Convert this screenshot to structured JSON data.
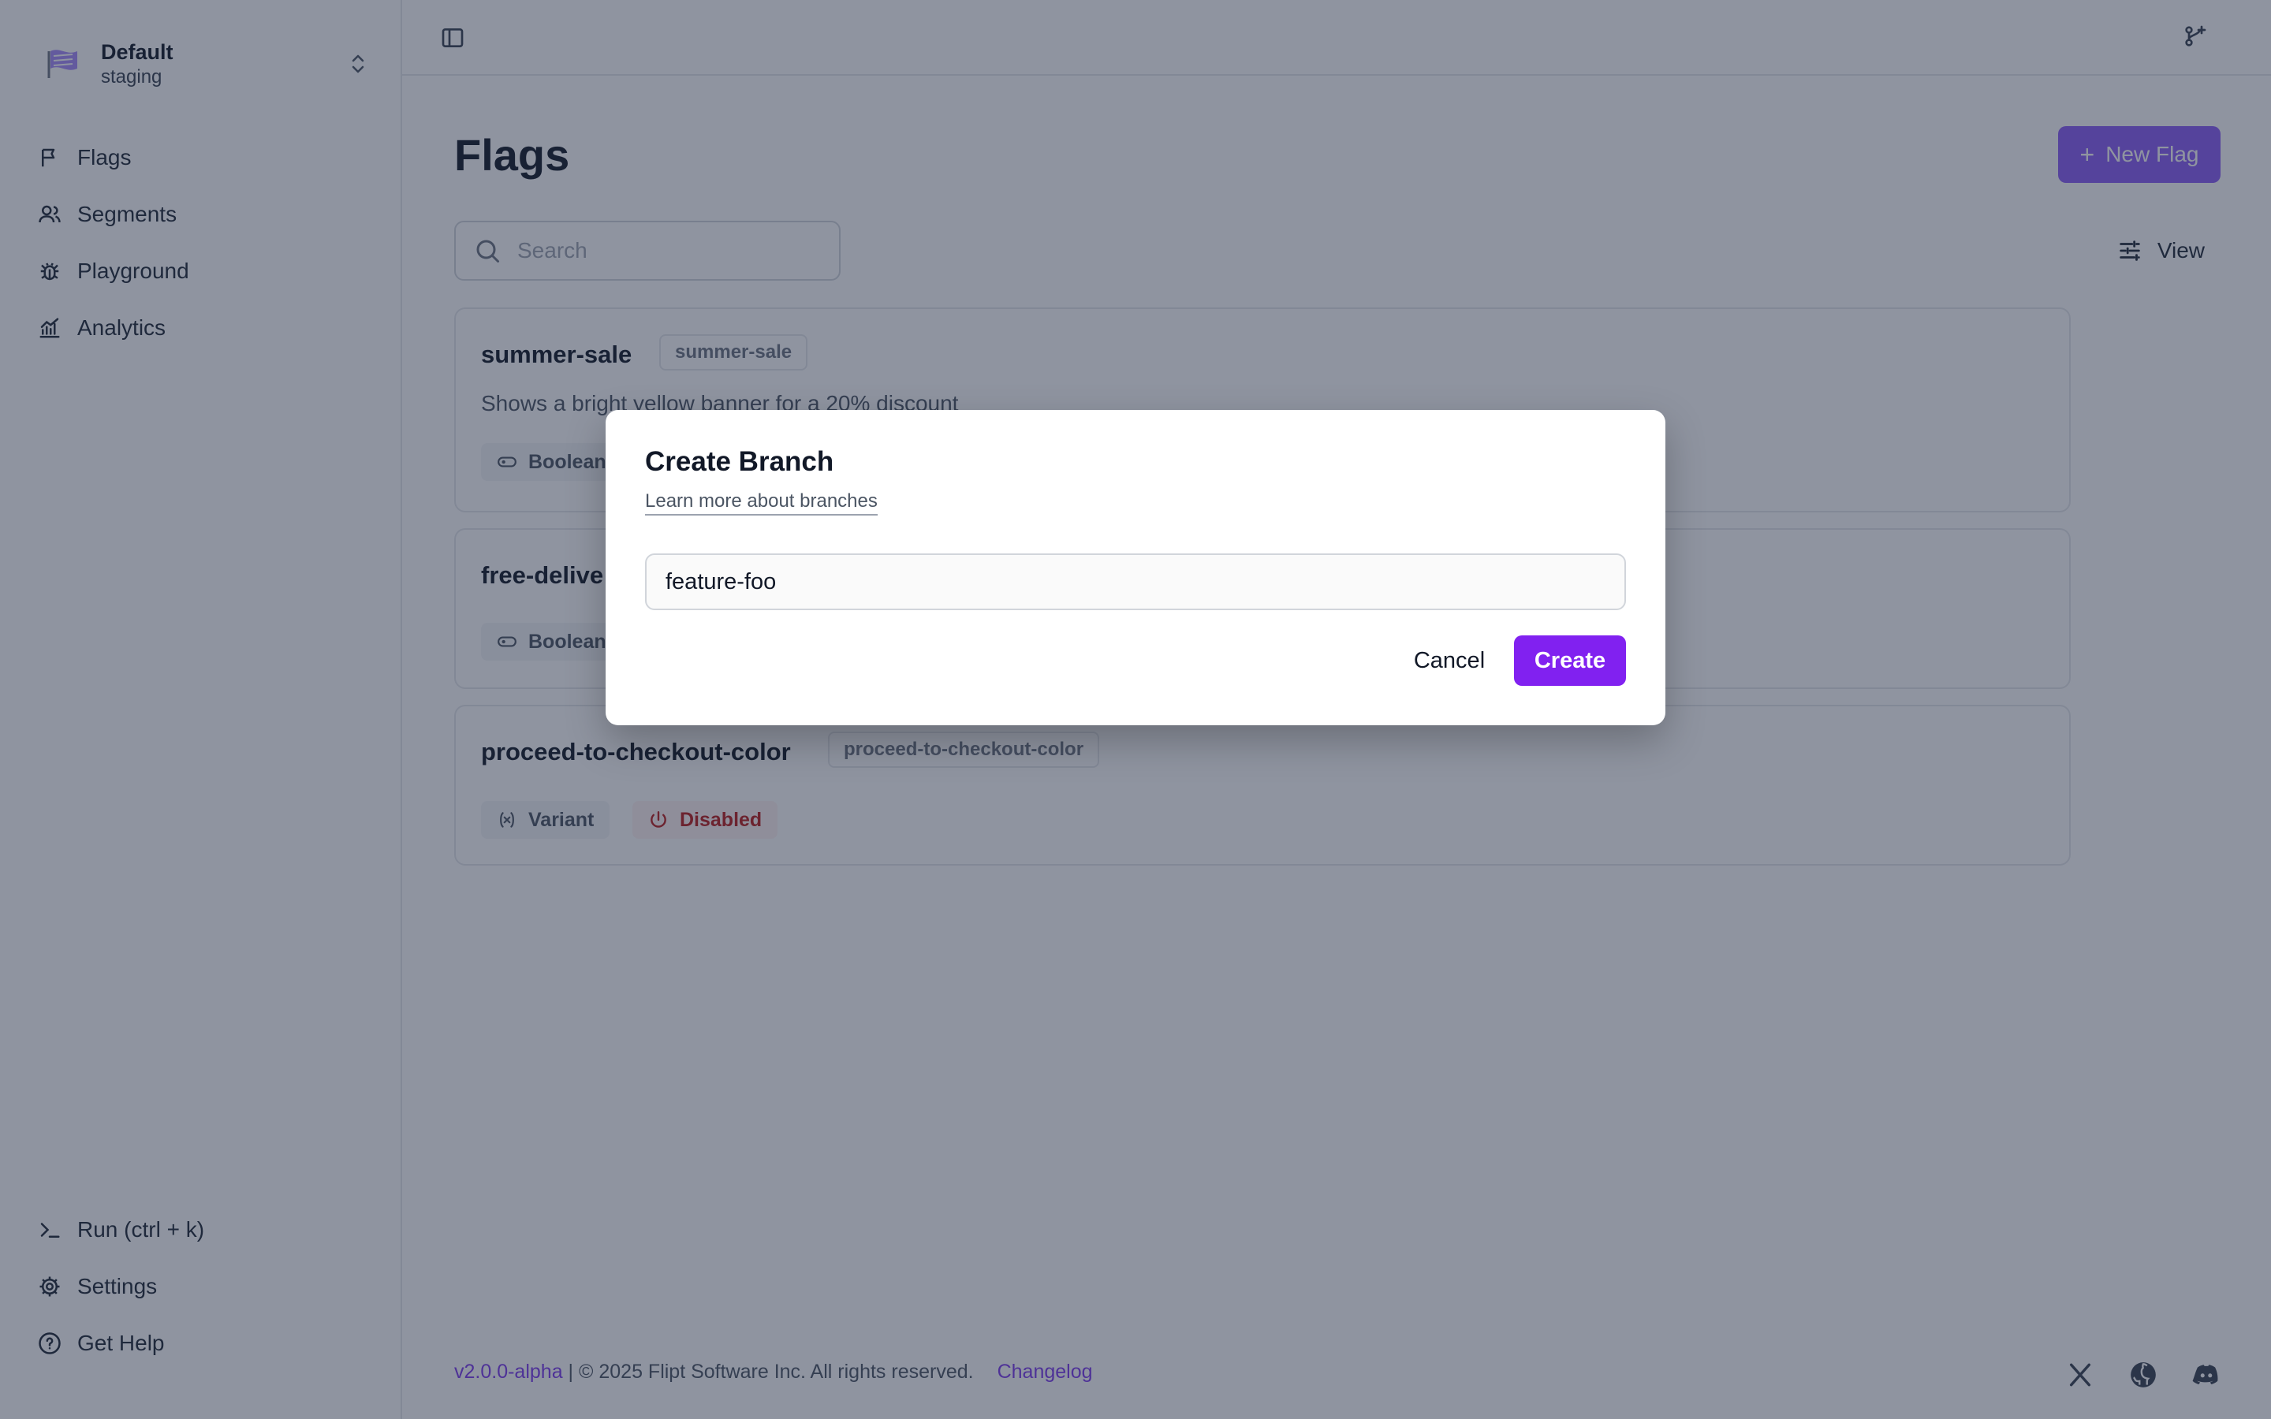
{
  "workspace": {
    "name": "Default",
    "environment": "staging"
  },
  "nav": [
    {
      "label": "Flags",
      "icon": "flag-icon"
    },
    {
      "label": "Segments",
      "icon": "users-icon"
    },
    {
      "label": "Playground",
      "icon": "bug-icon"
    },
    {
      "label": "Analytics",
      "icon": "chart-icon"
    }
  ],
  "nav_bottom": [
    {
      "label": "Run (ctrl + k)",
      "icon": "terminal-icon"
    },
    {
      "label": "Settings",
      "icon": "gear-icon"
    },
    {
      "label": "Get Help",
      "icon": "help-icon"
    }
  ],
  "page": {
    "title": "Flags",
    "new_flag_label": "New Flag",
    "search_placeholder": "Search",
    "view_label": "View"
  },
  "flags": [
    {
      "name": "summer-sale",
      "key": "summer-sale",
      "description": "Shows a bright yellow banner for a 20% discount",
      "type": "Boolean"
    },
    {
      "name": "free-delive",
      "type": "Boolean"
    },
    {
      "name": "proceed-to-checkout-color",
      "key": "proceed-to-checkout-color",
      "type": "Variant",
      "status": "Disabled"
    }
  ],
  "footer": {
    "version": "v2.0.0-alpha",
    "copyright": " | © 2025 Flipt Software Inc. All rights reserved.",
    "changelog": "Changelog"
  },
  "modal": {
    "title": "Create Branch",
    "link": "Learn more about branches",
    "input_value": "feature-foo",
    "cancel_label": "Cancel",
    "create_label": "Create"
  },
  "colors": {
    "accent": "#8121f0",
    "brand": "#8b5cf6",
    "danger": "#b91c1c"
  }
}
